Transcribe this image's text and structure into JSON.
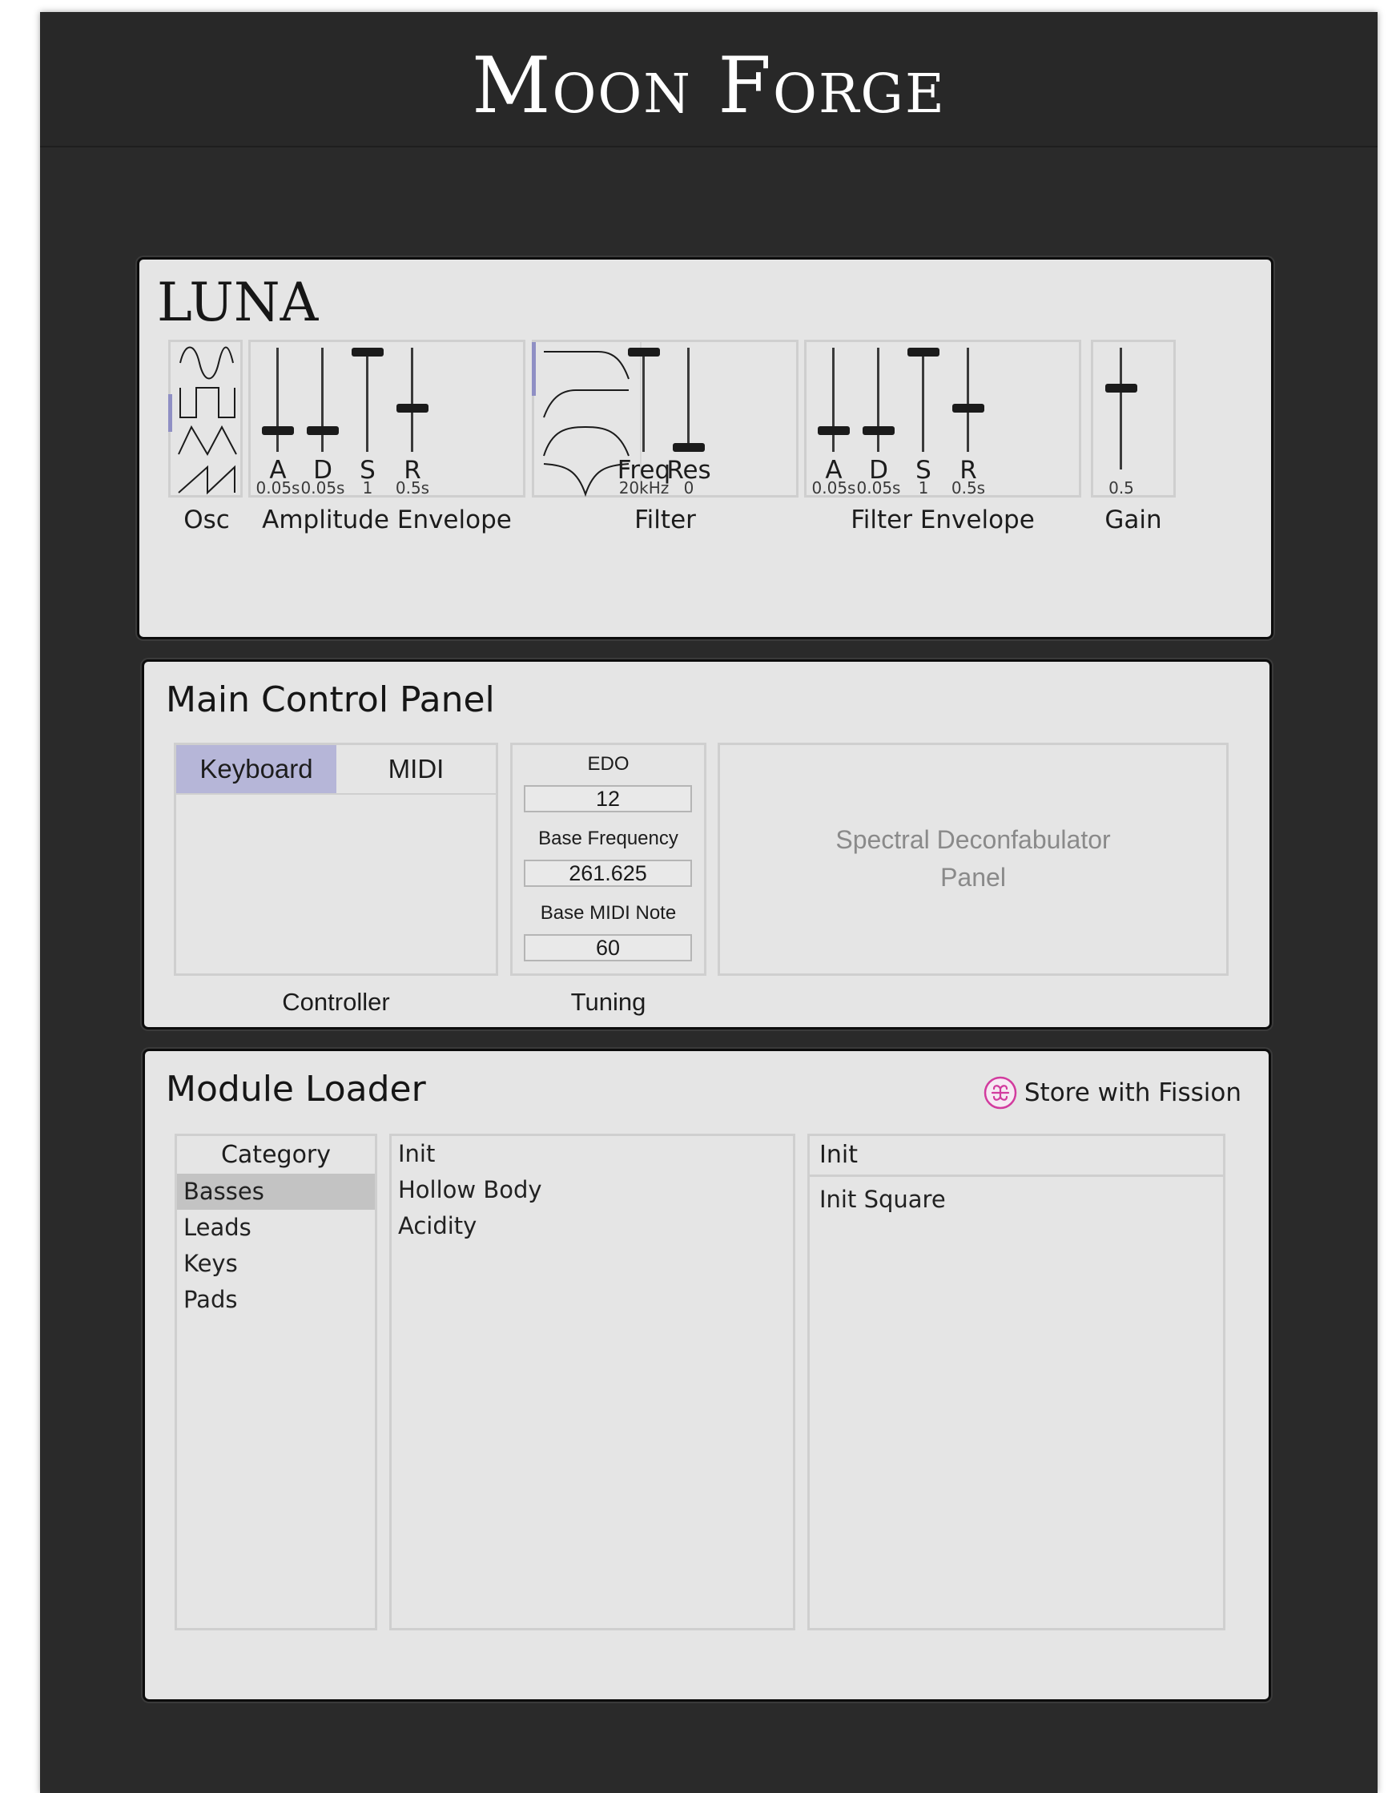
{
  "app": {
    "title": "Moon Forge"
  },
  "luna": {
    "title": "LUNA",
    "osc": {
      "label": "Osc",
      "waves": [
        "sine-wave-icon",
        "square-wave-icon",
        "triangle-wave-icon",
        "sawtooth-wave-icon"
      ],
      "selected": "square"
    },
    "amp_env": {
      "label": "Amplitude Envelope",
      "sliders": [
        {
          "letter": "A",
          "value": "0.05s",
          "level": 0.18
        },
        {
          "letter": "D",
          "value": "0.05s",
          "level": 0.18
        },
        {
          "letter": "S",
          "value": "1",
          "level": 1.0
        },
        {
          "letter": "R",
          "value": "0.5s",
          "level": 0.41
        }
      ]
    },
    "filter": {
      "label": "Filter",
      "types": [
        "lowpass-icon",
        "highpass-icon",
        "bandpass-icon",
        "notch-icon"
      ],
      "selected": "lowpass",
      "sliders": [
        {
          "letter": "Freq",
          "value": "20kHz",
          "level": 1.0
        },
        {
          "letter": "Res",
          "value": "0",
          "level": 0.0
        }
      ]
    },
    "filter_env": {
      "label": "Filter Envelope",
      "sliders": [
        {
          "letter": "A",
          "value": "0.05s",
          "level": 0.18
        },
        {
          "letter": "D",
          "value": "0.05s",
          "level": 0.18
        },
        {
          "letter": "S",
          "value": "1",
          "level": 1.0
        },
        {
          "letter": "R",
          "value": "0.5s",
          "level": 0.41
        }
      ]
    },
    "gain": {
      "label": "Gain",
      "value": "0.5",
      "level": 0.68
    }
  },
  "main_panel": {
    "title": "Main Control Panel",
    "controller": {
      "label": "Controller",
      "tabs": [
        {
          "label": "Keyboard",
          "active": true
        },
        {
          "label": "MIDI",
          "active": false
        }
      ]
    },
    "tuning": {
      "label": "Tuning",
      "edo_label": "EDO",
      "edo_value": "12",
      "base_freq_label": "Base Frequency",
      "base_freq_value": "261.625",
      "base_midi_label": "Base MIDI Note",
      "base_midi_value": "60"
    },
    "spectral": {
      "line1": "Spectral Deconfabulator",
      "line2": "Panel"
    }
  },
  "module_loader": {
    "title": "Module Loader",
    "store_label": "Store with Fission",
    "category_header": "Category",
    "categories": [
      "Basses",
      "Leads",
      "Keys",
      "Pads"
    ],
    "selected_category": "Basses",
    "patches": [
      "Init",
      "Hollow Body",
      "Acidity"
    ],
    "detail_header": "Init",
    "detail_items": [
      "Init Square"
    ]
  },
  "colors": {
    "accent": "#b6b6d8",
    "selection": "#8f8fc4",
    "background": "#2a2a2a",
    "panel": "#e5e5e5"
  }
}
